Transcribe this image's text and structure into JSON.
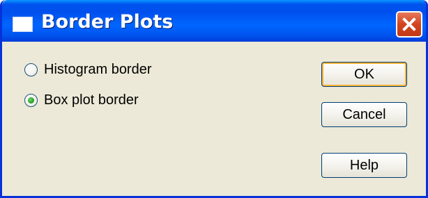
{
  "window": {
    "title": "Border Plots"
  },
  "options": {
    "histogram_label": "Histogram border",
    "histogram_selected": false,
    "boxplot_label": "Box plot border",
    "boxplot_selected": true
  },
  "buttons": {
    "ok_label": "OK",
    "cancel_label": "Cancel",
    "help_label": "Help"
  },
  "icons": {
    "window": "window-icon",
    "close": "close-icon",
    "radio": "radio-button"
  },
  "colors": {
    "titlebar": "#0053ee",
    "dialog_face": "#ece9d8",
    "close_button": "#d2441e",
    "default_button_focus": "#f8b337",
    "radio_selected": "#21a121"
  }
}
